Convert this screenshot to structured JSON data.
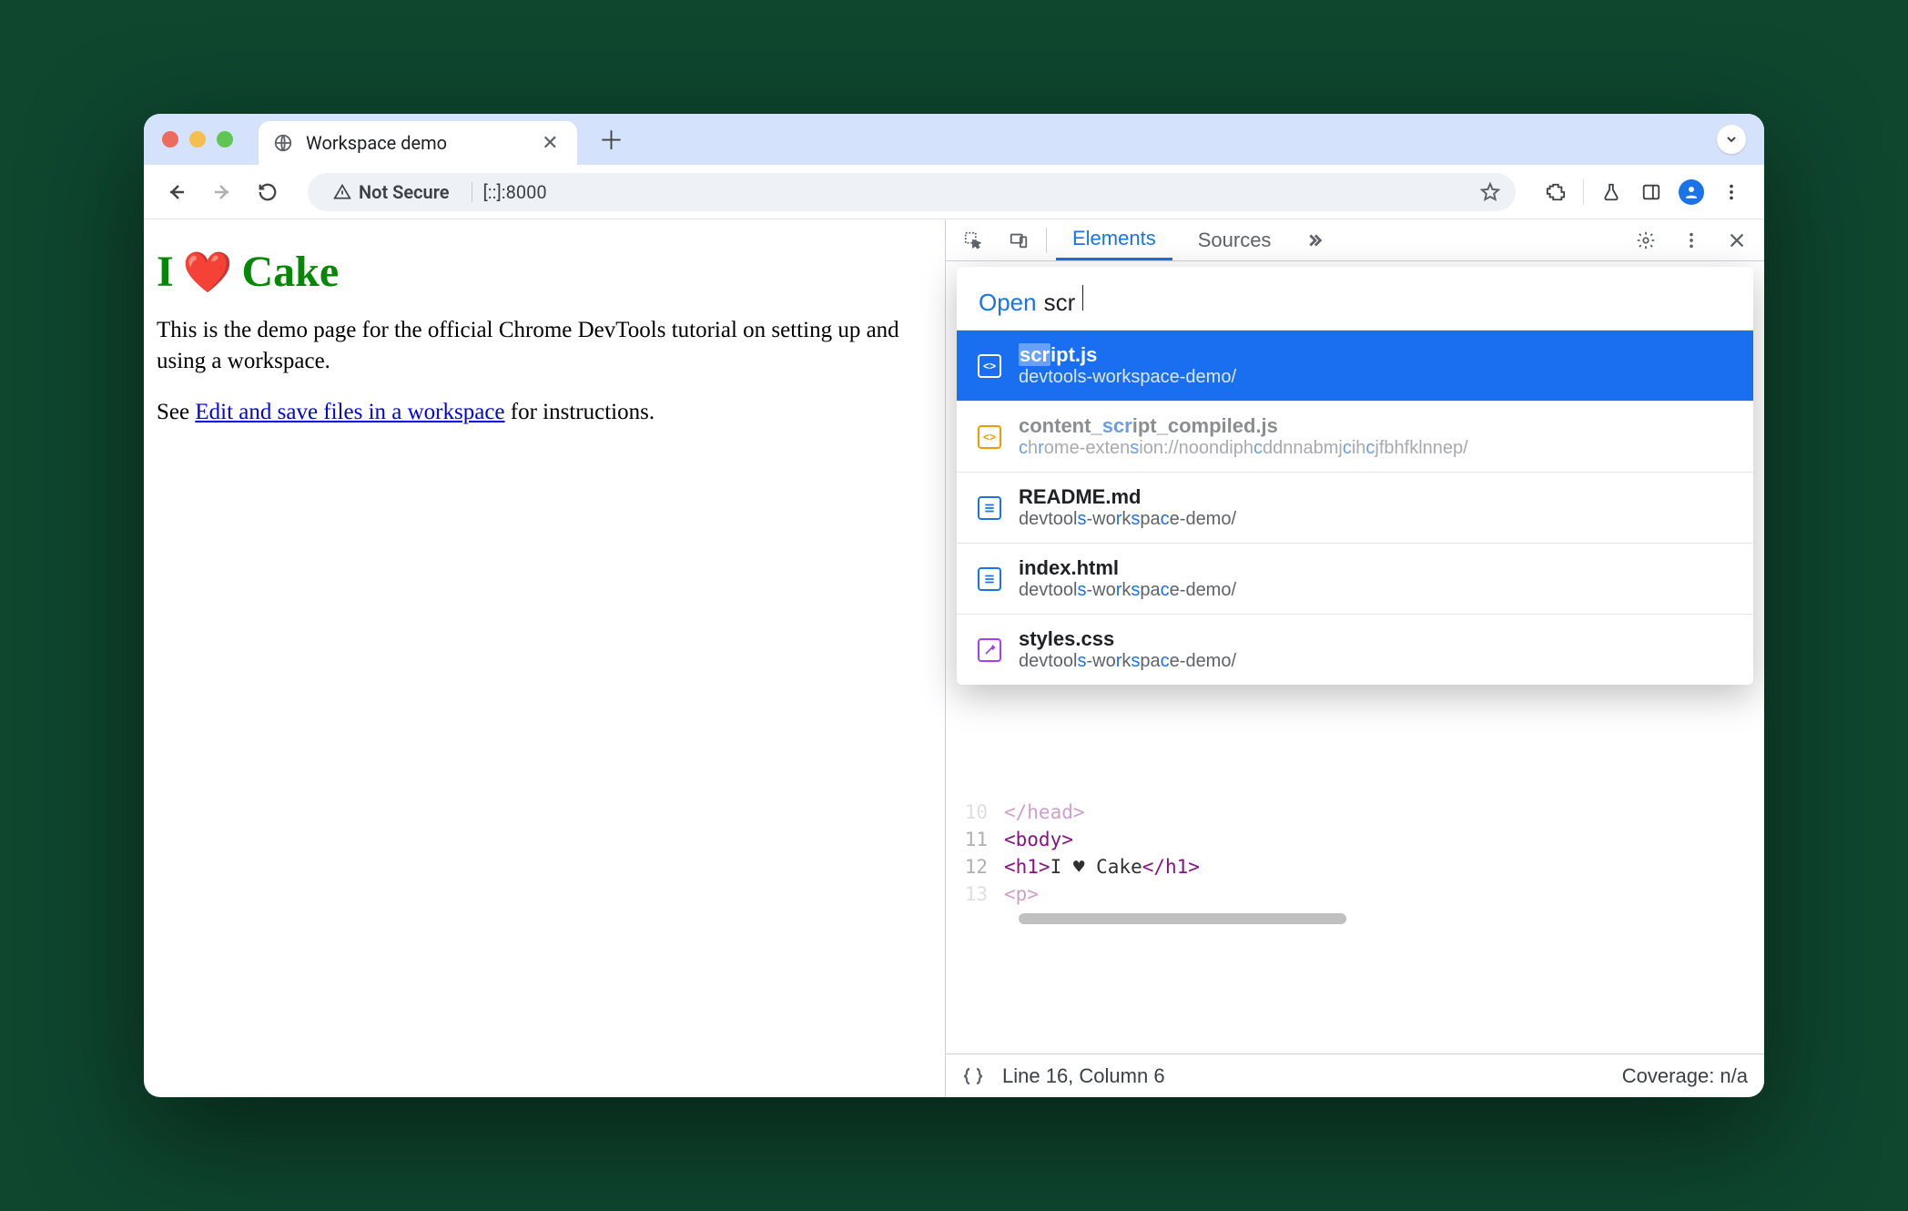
{
  "browser": {
    "tab_title": "Workspace demo",
    "security_label": "Not Secure",
    "url": "[::]:8000"
  },
  "page": {
    "h1_i": "I",
    "h1_cake": "Cake",
    "para1": "This is the demo page for the official Chrome DevTools tutorial on setting up and using a workspace.",
    "see_prefix": "See ",
    "link_text": "Edit and save files in a workspace",
    "see_suffix": " for instructions."
  },
  "devtools": {
    "tabs": {
      "elements": "Elements",
      "sources": "Sources"
    },
    "quick_open": {
      "prompt": "Open",
      "query": "scr",
      "results": [
        {
          "name": "script.js",
          "path": "devtools-workspace-demo/",
          "icon": "script",
          "selected": true
        },
        {
          "name": "content_script_compiled.js",
          "path": "chrome-extension://noondiphcddnnabmjcihcjfbhfklnnep/",
          "icon": "script-orange",
          "dim": true
        },
        {
          "name": "README.md",
          "path": "devtools-workspace-demo/",
          "icon": "doc"
        },
        {
          "name": "index.html",
          "path": "devtools-workspace-demo/",
          "icon": "doc"
        },
        {
          "name": "styles.css",
          "path": "devtools-workspace-demo/",
          "icon": "css"
        }
      ]
    },
    "code_lines": [
      {
        "n": "10",
        "html": "</head>",
        "ghost": true
      },
      {
        "n": "11",
        "html": "<body>"
      },
      {
        "n": "12",
        "html": "  <h1>I ♥ Cake</h1>"
      },
      {
        "n": "13",
        "html": "    <p>",
        "ghost": true
      }
    ],
    "status": {
      "pos": "Line 16, Column 6",
      "coverage": "Coverage: n/a"
    }
  }
}
